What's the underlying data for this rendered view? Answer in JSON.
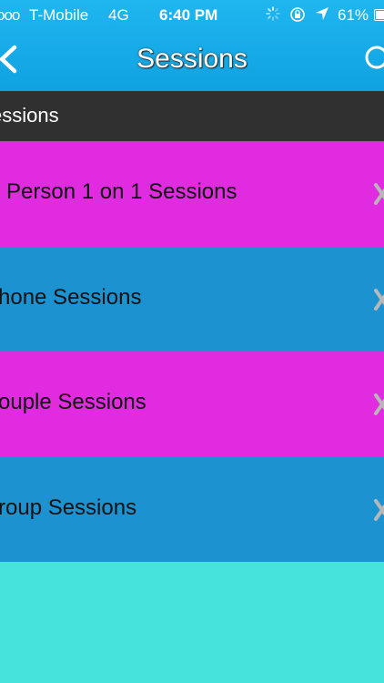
{
  "status_bar": {
    "signal": "ooo",
    "carrier": "T-Mobile",
    "network": "4G",
    "time": "6:40 PM",
    "battery": "61%",
    "battery_level": 0.61
  },
  "nav": {
    "title": "Sessions",
    "background_color": "#0fa2e1"
  },
  "section_header": {
    "label": "essions"
  },
  "sessions": [
    {
      "label": "Person 1 on 1 Sessions",
      "color": "#e02be0"
    },
    {
      "label": "hone Sessions",
      "color": "#1d92d1"
    },
    {
      "label": "ouple Sessions",
      "color": "#e02be0"
    },
    {
      "label": "roup Sessions",
      "color": "#1d92d1"
    }
  ],
  "empty_area_color": "#45e3dc"
}
